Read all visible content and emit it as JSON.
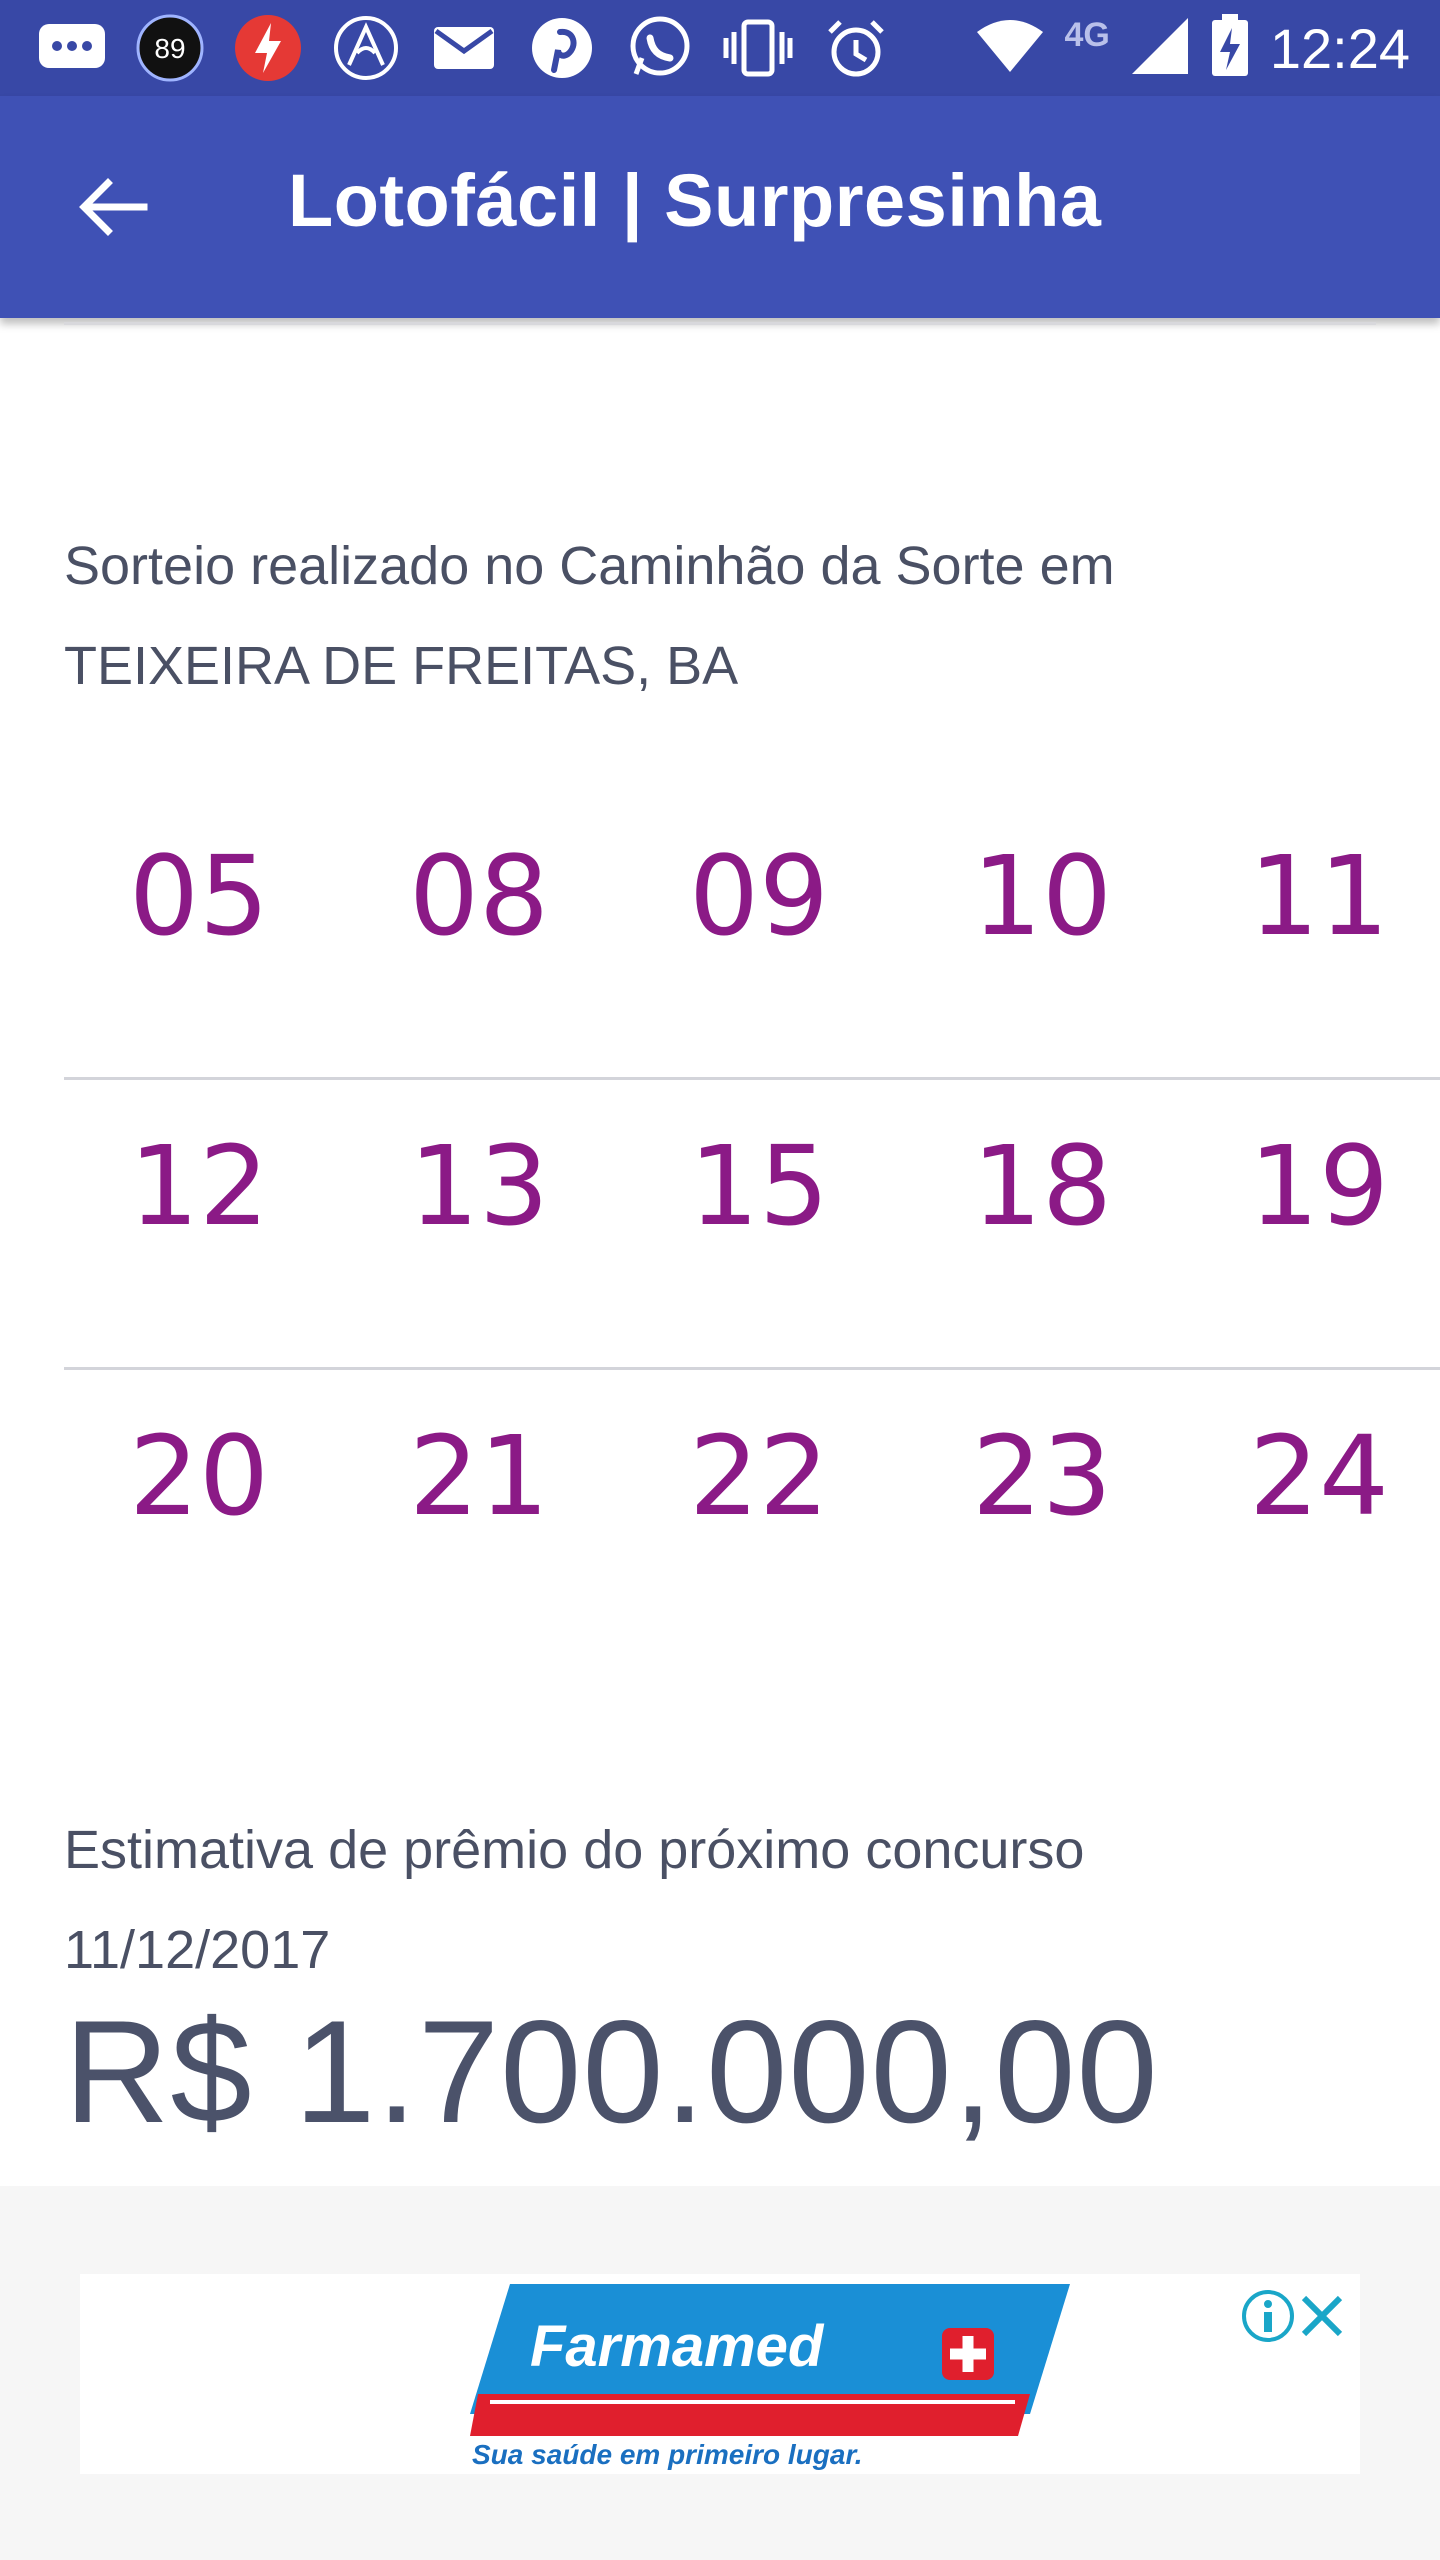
{
  "status_bar": {
    "time": "12:24",
    "network": "4G",
    "badge_count": "89",
    "icons": [
      "chat-icon",
      "badge-89-icon",
      "flash-app-icon",
      "app-icon",
      "mail-icon",
      "pinterest-icon",
      "whatsapp-icon",
      "vibrate-icon",
      "alarm-icon",
      "wifi-icon",
      "signal-icon",
      "battery-charging-icon"
    ]
  },
  "appbar": {
    "title": "Lotofácil | Surpresinha",
    "back_icon": "arrow-back-icon"
  },
  "draw_location": {
    "line1": "Sorteio realizado no Caminhão da Sorte em",
    "line2": "TEIXEIRA DE FREITAS, BA"
  },
  "numbers": {
    "rows": [
      [
        "05",
        "08",
        "09",
        "10",
        "11"
      ],
      [
        "12",
        "13",
        "15",
        "18",
        "19"
      ],
      [
        "20",
        "21",
        "22",
        "23",
        "24"
      ]
    ]
  },
  "prize": {
    "label": "Estimativa de prêmio do próximo concurso",
    "date": "11/12/2017",
    "value": "R$ 1.700.000,00"
  },
  "ad": {
    "brand": "Farmamed",
    "tagline": "Sua saúde em primeiro lugar.",
    "info_icon": "info-icon",
    "close_icon": "close-icon"
  },
  "colors": {
    "status_bar": "#3848a6",
    "app_bar": "#3f51b5",
    "number_color": "#8b1a86",
    "text_gray": "#4a5064",
    "ad_red": "#e01f2d",
    "ad_blue": "#1a8fd6"
  }
}
